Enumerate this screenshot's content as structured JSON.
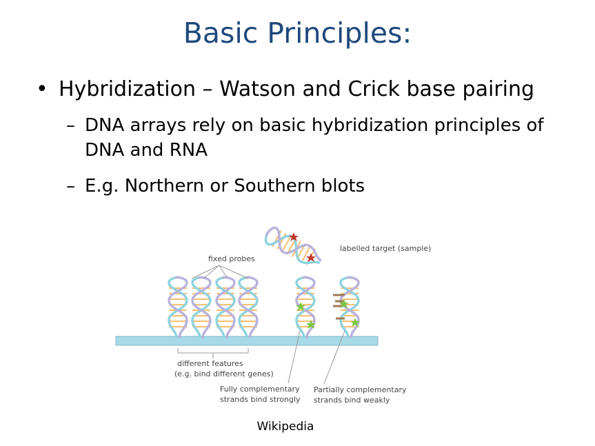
{
  "slide": {
    "title": "Basic Principles:",
    "bullet": "Hybridization – Watson and Crick base pairing",
    "bullet_marker": "•",
    "sub_marker": "–",
    "sub_items": [
      "DNA arrays rely on basic hybridization principles of DNA and RNA",
      "E.g. Northern or Southern blots"
    ],
    "credit": "Wikipedia"
  },
  "figure": {
    "fixed_probes": "fixed probes",
    "labelled_target": "labelled target (sample)",
    "features_line1": "different features",
    "features_line2": "(e.g. bind different genes)",
    "full_line1": "Fully complementary",
    "full_line2": "strands bind strongly",
    "partial_line1": "Partially complementary",
    "partial_line2": "strands bind weakly"
  },
  "colors": {
    "title": "#1f497d",
    "strand_blue": "#8fd3df",
    "strand_purple": "#b9b3dd",
    "rung_orange": "#f5c27a",
    "slide_surface": "#a8d9e6",
    "star_green": "#7ac943",
    "star_red": "#c0392b"
  }
}
